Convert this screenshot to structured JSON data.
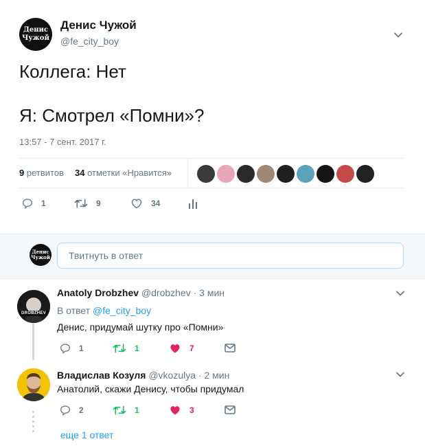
{
  "tweet": {
    "author_name": "Денис Чужой",
    "author_handle": "@fe_city_boy",
    "avatar_text": "Денис\nЧужой",
    "text": "Коллега: Нет\n\nЯ: Смотрел «Помни»?",
    "timestamp": "13:57 - 7 сент. 2017 г.",
    "retweets_count": "9",
    "retweets_label": "ретвитов",
    "likes_count": "34",
    "likes_label": "отметки «Нравится»",
    "liker_faces": [
      "#3b3b3b",
      "#e8a6b8",
      "#2a2a2a",
      "#a08878",
      "#1f1f1f",
      "#5aa3b8",
      "#151515",
      "#c44a4a",
      "#222"
    ],
    "actions": {
      "replies": "1",
      "retweets": "9",
      "likes": "34"
    }
  },
  "reply_box": {
    "avatar_text": "Денис\nЧужой",
    "placeholder": "Твитнуть в ответ"
  },
  "replies": [
    {
      "name": "Anatoly Drobzhev",
      "handle_time": "@drobzhev · 3 мин",
      "in_reply_prefix": "В ответ",
      "in_reply_handle": "@fe_city_boy",
      "text": "Денис, придумай шутку про «Помни»",
      "avatar_label": "DROBZHEV",
      "actions": {
        "replies": "1",
        "retweets": "1",
        "likes": "7"
      }
    },
    {
      "name": "Владислав Козуля",
      "handle_time": "@vkozulya · 2 мин",
      "text": "Анатолий, скажи Денису, чтобы придумал",
      "actions": {
        "replies": "2",
        "retweets": "1",
        "likes": "3"
      }
    }
  ],
  "more_replies": "еще 1 ответ",
  "colors": {
    "accent": "#1da1f2",
    "retweet_green": "#17bf63",
    "like_red": "#e0245e",
    "muted": "#657786"
  }
}
